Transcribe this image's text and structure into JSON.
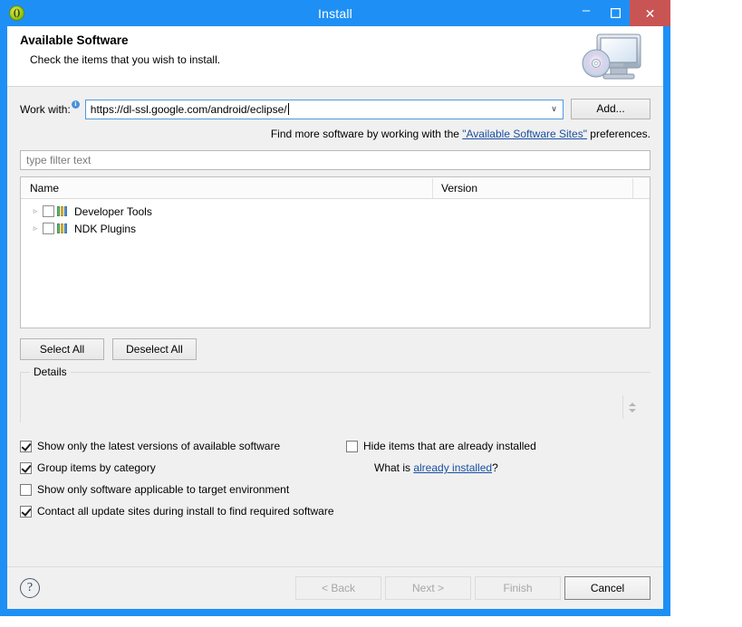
{
  "window": {
    "title": "Install",
    "app_icon": "eclipse-icon",
    "controls": {
      "minimize": "minimize-icon",
      "maximize": "maximize-icon",
      "close": "close-icon",
      "close_glyph": "✕",
      "minimize_glyph": "–"
    },
    "accent_color": "#1e90f5",
    "close_color": "#c95454"
  },
  "banner": {
    "title": "Available Software",
    "subtitle": "Check the items that you wish to install.",
    "art": "monitor-with-disc-icon"
  },
  "work_with": {
    "label": "Work with:",
    "info_badge": "i",
    "value": "https://dl-ssl.google.com/android/eclipse/",
    "dropdown_arrow": "∨",
    "add_label": "Add..."
  },
  "hint": {
    "prefix": "Find more software by working with the ",
    "link": "\"Available Software Sites\"",
    "suffix": " preferences."
  },
  "filter": {
    "placeholder": "type filter text",
    "value": ""
  },
  "tree": {
    "columns": [
      "Name",
      "Version"
    ],
    "rows": [
      {
        "label": "Developer Tools",
        "version": "",
        "checked": false,
        "expanded": false,
        "twisty": "▹",
        "icon": "category-icon"
      },
      {
        "label": "NDK Plugins",
        "version": "",
        "checked": false,
        "expanded": false,
        "twisty": "▹",
        "icon": "category-icon"
      }
    ]
  },
  "selection_buttons": {
    "select_all": "Select All",
    "deselect_all": "Deselect All"
  },
  "details": {
    "legend": "Details",
    "text": "",
    "spinner_up": "scroll-up-arrow",
    "spinner_down": "scroll-down-arrow"
  },
  "options": {
    "left": [
      {
        "label": "Show only the latest versions of available software",
        "checked": true
      },
      {
        "label": "Group items by category",
        "checked": true
      },
      {
        "label": "Show only software applicable to target environment",
        "checked": false
      },
      {
        "label": "Contact all update sites during install to find required software",
        "checked": true
      }
    ],
    "right": [
      {
        "label": "Hide items that are already installed",
        "checked": false
      }
    ],
    "note_prefix": "What is ",
    "note_link": "already installed",
    "note_suffix": "?"
  },
  "footer": {
    "help": "?",
    "buttons": [
      {
        "label": "< Back",
        "enabled": false,
        "default": false
      },
      {
        "label": "Next >",
        "enabled": false,
        "default": false
      },
      {
        "label": "Finish",
        "enabled": false,
        "default": false
      },
      {
        "label": "Cancel",
        "enabled": true,
        "default": true
      }
    ]
  }
}
